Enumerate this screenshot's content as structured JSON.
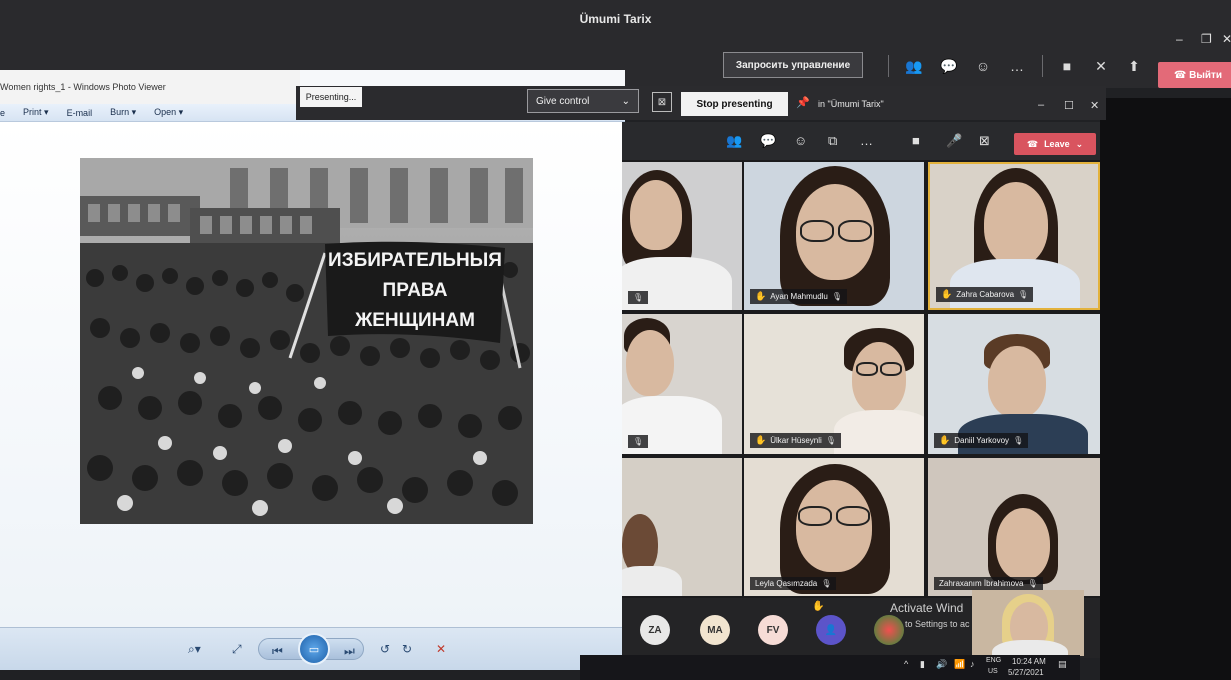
{
  "app": {
    "title": "Ümumi Tarix",
    "request_control": "Запросить управление",
    "leave_top": "Выйти"
  },
  "presenting": {
    "tag": "Presenting...",
    "give_control": "Give control",
    "stop_presenting": "Stop presenting",
    "meeting_ref": "in \"Ümumi Tarix\""
  },
  "photo_viewer": {
    "title": "Women rights_1 - Windows Photo Viewer",
    "menu": [
      "e",
      "Print",
      "E-mail",
      "Burn",
      "Open"
    ],
    "banner_lines": [
      "ИЗБИРАТЕЛЬНЫЯ",
      "ПРАВА",
      "ЖЕНЩИНАМ"
    ]
  },
  "meeting_toolbar": {
    "leave": "Leave"
  },
  "participants": [
    {
      "name": "",
      "hand": false
    },
    {
      "name": "Ayan Mahmudlu",
      "hand": true
    },
    {
      "name": "Zahra Cabarova",
      "hand": true
    },
    {
      "name": "",
      "hand": false
    },
    {
      "name": "Ülkar Hüseynli",
      "hand": true
    },
    {
      "name": "Daniil Yarkovoy",
      "hand": true
    },
    {
      "name": "",
      "hand": false
    },
    {
      "name": "Leyla Qasımzada",
      "hand": false
    },
    {
      "name": "Zahraxanım İbrahimova",
      "hand": false
    }
  ],
  "bottom_avatars": [
    "ZA",
    "MA",
    "FV"
  ],
  "activate": {
    "line1": "Activate Wind",
    "line2": "to Settings to ac"
  },
  "taskbar": {
    "lang1": "ENG",
    "lang2": "US",
    "time": "10:24 AM",
    "date": "5/27/2021"
  },
  "colors": {
    "accent_red": "#e36a78",
    "leave_red": "#d9545f",
    "hand_yellow": "#f0b000",
    "active_speaker": "#e3b23c"
  }
}
